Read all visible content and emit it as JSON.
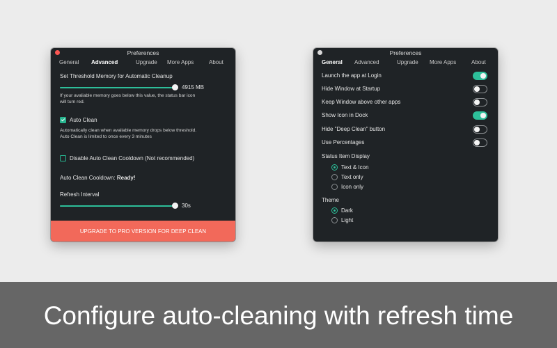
{
  "left_window": {
    "title": "Preferences",
    "tabs": [
      "General",
      "Advanced",
      "Upgrade",
      "More Apps",
      "About"
    ],
    "active_tab": "Advanced",
    "threshold_heading": "Set Threshold Memory for Automatic Cleanup",
    "threshold_value": "4915 MB",
    "threshold_level": 1.0,
    "threshold_desc_line1": "If your avaliable memory goes below this value, the status bar icon",
    "threshold_desc_line2": "will turn red.",
    "auto_clean_label": "Auto Clean",
    "auto_clean_checked": true,
    "auto_clean_desc_line1": "Automatically clean when available memory drops below threshold.",
    "auto_clean_desc_line2": "Auto Clean is limited to once every 3 minutes",
    "cooldown_disable_label": "Disable Auto Clean Cooldown (Not recommended)",
    "cooldown_disable_checked": false,
    "cooldown_status_label": "Auto Clean Cooldown:",
    "cooldown_status_value": "Ready!",
    "refresh_label": "Refresh Interval",
    "refresh_value": "30s",
    "refresh_level": 1.0,
    "upgrade_button": "UPGRADE TO PRO VERSION FOR DEEP CLEAN"
  },
  "right_window": {
    "title": "Preferences",
    "tabs": [
      "General",
      "Advanced",
      "Upgrade",
      "More Apps",
      "About"
    ],
    "active_tab": "General",
    "toggles": [
      {
        "label": "Launch the app at Login",
        "on": true
      },
      {
        "label": "Hide Window at Startup",
        "on": false
      },
      {
        "label": "Keep Window above other apps",
        "on": false
      },
      {
        "label": "Show Icon in Dock",
        "on": true
      },
      {
        "label": "Hide \"Deep Clean\" button",
        "on": false
      },
      {
        "label": "Use Percentages",
        "on": false
      }
    ],
    "status_item_heading": "Status Item Display",
    "status_item_options": [
      {
        "label": "Text & Icon",
        "selected": true
      },
      {
        "label": "Text only",
        "selected": false
      },
      {
        "label": "Icon only",
        "selected": false
      }
    ],
    "theme_heading": "Theme",
    "theme_options": [
      {
        "label": "Dark",
        "selected": true
      },
      {
        "label": "Light",
        "selected": false
      }
    ]
  },
  "caption": "Configure auto-cleaning with refresh time",
  "colors": {
    "accent": "#2dbf9a",
    "upgrade": "#f2695a",
    "window_bg": "#1f2326",
    "page_bg": "#ececec",
    "caption_bg": "#666666"
  }
}
